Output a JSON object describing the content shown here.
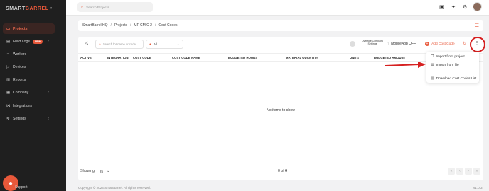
{
  "brand": {
    "part1": "SMART",
    "part2": "BARREL",
    "expand_icon": "chevrons-right-icon"
  },
  "sidebar": {
    "items": [
      {
        "label": "Projects",
        "icon": "folder-icon",
        "active": true
      },
      {
        "label": "Field Logs",
        "icon": "clipboard-icon",
        "badge": "NEW",
        "has_chevron": true
      },
      {
        "label": "Workers",
        "icon": "user-icon"
      },
      {
        "label": "Devices",
        "icon": "device-icon"
      },
      {
        "label": "Reports",
        "icon": "chart-icon"
      },
      {
        "label": "Company",
        "icon": "building-icon",
        "has_chevron": true
      },
      {
        "label": "Integrations",
        "icon": "link-icon"
      },
      {
        "label": "Settings",
        "icon": "gear-icon",
        "has_chevron": true
      }
    ],
    "support_label": "Support"
  },
  "topbar": {
    "search_placeholder": "Search Projects..."
  },
  "breadcrumb": [
    "SmartBarrel HQ",
    "Projects",
    "MF CMIC 2",
    "Cost Codes"
  ],
  "toolbar": {
    "search_placeholder": "Search for name or code",
    "filter_value": "All",
    "override_label": "Override Company Settings",
    "mobile_app_label": "MobileApp OFF",
    "add_cost_code_label": "Add Cost Code"
  },
  "table": {
    "columns": [
      "ACTIVE",
      "INTEGRATION",
      "COST CODE",
      "COST CODE NAME",
      "BUDGETED HOURS",
      "MATERIAL QUANTITY",
      "UNITS",
      "BUDGETED AMOUNT"
    ],
    "empty_text": "No items to show"
  },
  "footer": {
    "showing_label": "Showing:",
    "page_size": "25",
    "count_prefix": "0 of ",
    "count_total": "0"
  },
  "dropdown": {
    "items": [
      "Import from project",
      "Import from file",
      "Download Cost Codes List"
    ]
  },
  "copyright": "Copyright © 2024 SmartBarrel. All rights reserved.",
  "version": "v1.0.3",
  "colors": {
    "accent": "#e8583a",
    "sidebar_bg": "#1f1f1f",
    "annotation_red": "#d62020"
  }
}
